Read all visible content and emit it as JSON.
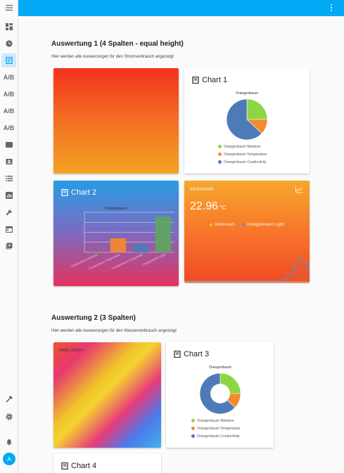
{
  "sidebar": {
    "items": [
      {
        "icon": "menu-icon"
      },
      {
        "icon": "dashboard-icon"
      },
      {
        "icon": "clock-icon"
      },
      {
        "icon": "receipt-icon"
      },
      {
        "icon": "ab-icon",
        "label": "A/B"
      },
      {
        "icon": "ab-icon",
        "label": "A/B"
      },
      {
        "icon": "ab-icon",
        "label": "A/B"
      },
      {
        "icon": "ab-icon",
        "label": "A/B"
      },
      {
        "icon": "rectangle-icon"
      },
      {
        "icon": "contact-icon"
      },
      {
        "icon": "list-icon"
      },
      {
        "icon": "chart-icon"
      },
      {
        "icon": "wrench-icon"
      },
      {
        "icon": "calendar-icon"
      },
      {
        "icon": "play-icon"
      },
      {
        "icon": "hammer-icon"
      },
      {
        "icon": "gear-icon"
      },
      {
        "icon": "bell-icon"
      }
    ],
    "avatar": "A"
  },
  "sections": [
    {
      "title": "Auswertung 1 (4 Spalten - equal height)",
      "subtitle": "Hier werden alle Auswerungen für den Stromverbrauch angezeigt"
    },
    {
      "title": "Auswertung 2 (3 Spalten)",
      "subtitle": "Hier werden alle Auswerungen für den Wasserverbrauch angezeigt"
    }
  ],
  "cards": {
    "chart1": {
      "title": "Chart 1"
    },
    "chart2": {
      "title": "Chart 2"
    },
    "chart3": {
      "title": "Chart 3"
    },
    "chart4": {
      "title": "Chart 4"
    },
    "gauge": {
      "title": "Innenraum",
      "value": "22.96",
      "unit": "°C",
      "legend1": "Innenraum",
      "legend2": "Orangenbaum Light"
    },
    "hello": {
      "text": "Hello, Admin"
    }
  },
  "colors": {
    "accent": "#03a9f4",
    "moisture": "#8ed544",
    "temperature": "#f58a2c",
    "conductivity": "#4f7ab8",
    "bar_green": "#5ea65e"
  },
  "chart_data": [
    {
      "type": "pie",
      "title": "Orangenbaum",
      "categories": [
        "Orangenbaum Moisture",
        "Orangenbaum Temperature",
        "Orangenbaum Conductivity"
      ],
      "values": [
        25,
        12,
        63
      ]
    },
    {
      "type": "bar",
      "title": "Orangenbaum",
      "categories": [
        "Orangenbaum Moisture",
        "Orangenbaum Temperature",
        "Orangenbaum Conductivity",
        "Orangenbaum Light"
      ],
      "values": [
        2,
        35,
        20,
        89
      ],
      "ylim": [
        0,
        100
      ]
    },
    {
      "type": "pie",
      "title": "Orangenbaum",
      "categories": [
        "Orangenbaum Moisture",
        "Orangenbaum Temperature",
        "Orangenbaum Conductivity"
      ],
      "values": [
        25,
        12,
        63
      ]
    }
  ]
}
